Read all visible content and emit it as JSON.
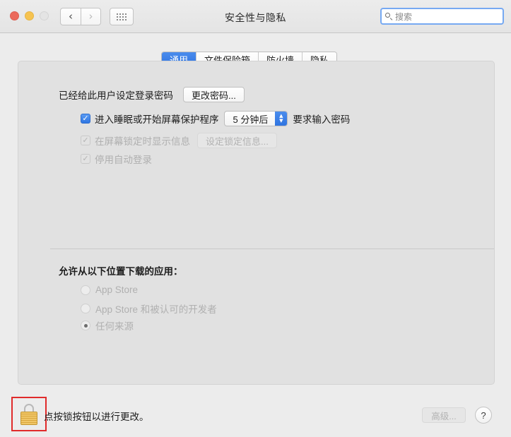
{
  "window": {
    "title": "安全性与隐私",
    "traffic_lights": [
      "close",
      "minimize",
      "zoom"
    ],
    "nav": {
      "back": "‹",
      "forward": "›",
      "show_all": "show-all-grid"
    }
  },
  "search": {
    "placeholder": "搜索",
    "value": "",
    "icon": "search-icon"
  },
  "tabs": [
    {
      "label": "通用",
      "active": true
    },
    {
      "label": "文件保险箱",
      "active": false
    },
    {
      "label": "防火墙",
      "active": false
    },
    {
      "label": "隐私",
      "active": false
    }
  ],
  "general": {
    "password_status": "已经给此用户设定登录密码",
    "change_password_button": "更改密码...",
    "require_password": {
      "prefix": "进入睡眠或开始屏幕保护程序",
      "delay_value": "5 分钟后",
      "suffix": "要求输入密码",
      "checked": true
    },
    "show_message": {
      "label": "在屏幕锁定时显示信息",
      "button": "设定锁定信息...",
      "checked": true,
      "enabled": false
    },
    "disable_auto_login": {
      "label": "停用自动登录",
      "checked": true,
      "enabled": false
    },
    "download_section": {
      "heading": "允许从以下位置下载的应用：",
      "options": [
        {
          "label": "App Store",
          "selected": false
        },
        {
          "label": "App Store 和被认可的开发者",
          "selected": false
        },
        {
          "label": "任何来源",
          "selected": true
        }
      ]
    }
  },
  "footer": {
    "lock_icon": "lock-closed-icon",
    "lock_hint": "点按锁按钮以进行更改。",
    "advanced_button": "高级...",
    "help_button": "?",
    "highlight_color": "#e02b2b"
  }
}
